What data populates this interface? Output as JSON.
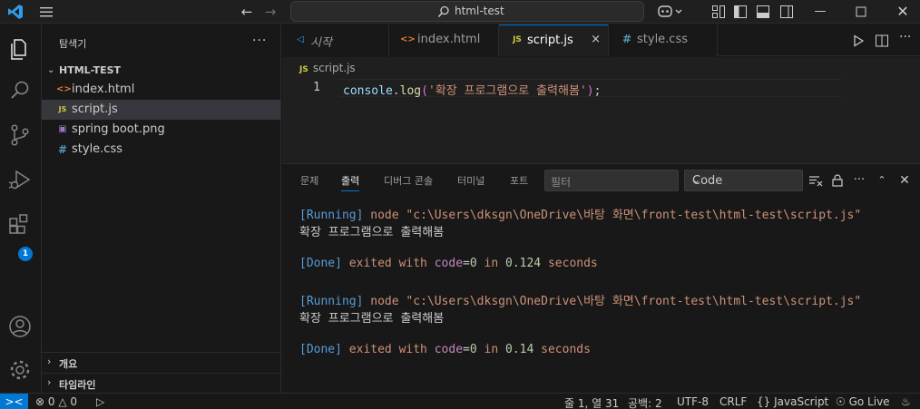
{
  "titlebar": {
    "search_text": "html-test",
    "back_icon": "arrow-left-icon",
    "forward_icon": "arrow-right-icon"
  },
  "activity_bar": {
    "items": [
      "explorer-icon",
      "search-icon",
      "source-control-icon",
      "run-debug-icon",
      "extensions-icon"
    ],
    "extensions_badge": "1",
    "bottom": [
      "account-icon",
      "manage-gear-icon"
    ]
  },
  "sidebar": {
    "title": "탐색기",
    "more": "···",
    "folder": "HTML-TEST",
    "files": [
      {
        "icon": "<>",
        "name": "index.html",
        "color": "#e37933"
      },
      {
        "icon": "JS",
        "name": "script.js",
        "color": "#cbcb41"
      },
      {
        "icon": "▣",
        "name": "spring boot.png",
        "color": "#a074c4"
      },
      {
        "icon": "#",
        "name": "style.css",
        "color": "#519aba"
      }
    ],
    "sections": [
      "개요",
      "타임라인"
    ]
  },
  "tabs": [
    {
      "icon": "◁",
      "name": "시작",
      "color": "#3794ff",
      "italic": true
    },
    {
      "icon": "<>",
      "name": "index.html",
      "color": "#e37933"
    },
    {
      "icon": "JS",
      "name": "script.js",
      "color": "#cbcb41",
      "active": true,
      "close": "×"
    },
    {
      "icon": "#",
      "name": "style.css",
      "color": "#519aba"
    }
  ],
  "editor": {
    "breadcrumb_icon": "JS",
    "breadcrumb": "script.js",
    "line_number": "1",
    "code": {
      "obj": "console",
      "dot": ".",
      "fn": "log",
      "open": "(",
      "str": "'확장 프로그램으로 출력해봄'",
      "close": ")",
      "semi": ";"
    }
  },
  "panel": {
    "tabs": [
      "문제",
      "출력",
      "디버그 콘솔",
      "터미널",
      "포트"
    ],
    "active_tab": "출력",
    "filter_placeholder": "필터",
    "select_value": "Code",
    "output": [
      {
        "running": "[Running]",
        "cmd": " node \"c:\\Users\\dksgn\\OneDrive\\바탕 화면\\front-test\\html-test\\script.js\""
      },
      {
        "text": "확장 프로그램으로 출력해봄"
      },
      {
        "done": "[Done]",
        "exited": " exited with ",
        "code_label": "code",
        "eq": "=",
        "code_val": "0",
        "in": " in ",
        "secs": "0.124",
        "unit": " seconds"
      },
      {
        "running": "[Running]",
        "cmd": " node \"c:\\Users\\dksgn\\OneDrive\\바탕 화면\\front-test\\html-test\\script.js\""
      },
      {
        "text": "확장 프로그램으로 출력해봄"
      },
      {
        "done": "[Done]",
        "exited": " exited with ",
        "code_label": "code",
        "eq": "=",
        "code_val": "0",
        "in": " in ",
        "secs": "0.14",
        "unit": " seconds"
      }
    ]
  },
  "statusbar": {
    "remote": "><",
    "errors": "0",
    "warnings": "0",
    "position": "줄 1, 열 31",
    "spaces": "공백: 2",
    "encoding": "UTF-8",
    "eol": "CRLF",
    "language": "JavaScript",
    "golive": "Go Live"
  }
}
